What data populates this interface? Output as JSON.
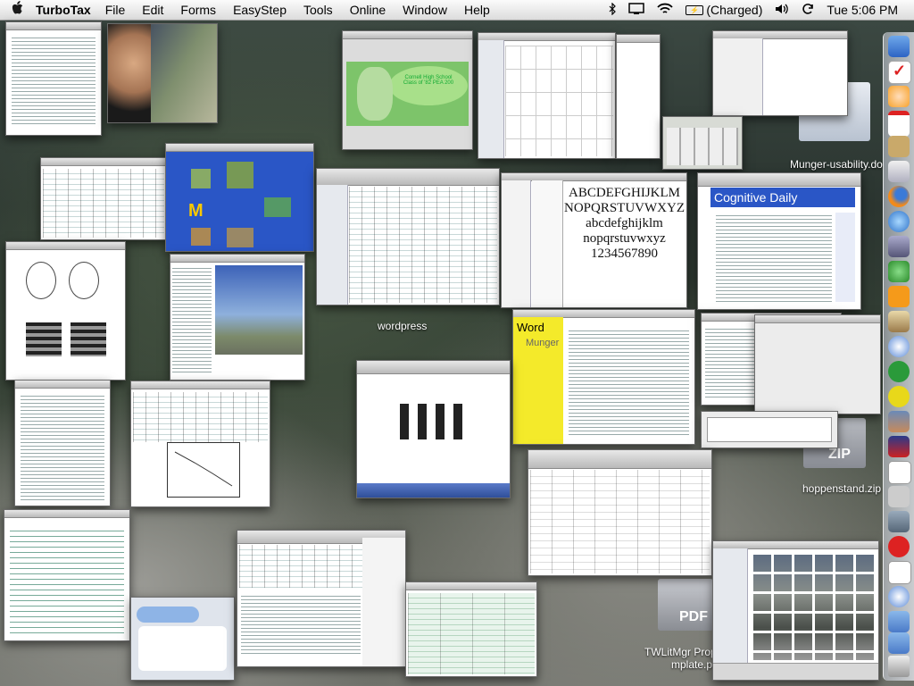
{
  "menubar": {
    "app_name": "TurboTax",
    "items": [
      "File",
      "Edit",
      "Forms",
      "EasyStep",
      "Tools",
      "Online",
      "Window",
      "Help"
    ],
    "battery_status": "(Charged)",
    "clock": "Tue 5:06 PM"
  },
  "windows": {
    "cornell_title": "Cornell High School",
    "cornell_class": "Class of '82 PEA 200",
    "font_lines": [
      "ABCDEFGHIJKLM",
      "NOPQRSTUVWXYZ",
      "abcdefghijklm",
      "nopqrstuvwxyz",
      "1234567890"
    ],
    "blog_title": "Cognitive Daily",
    "word_brand": "Word",
    "word_sub": "Munger"
  },
  "desktop_labels": {
    "munger": "Munger-usability.do",
    "wordpress": "wordpress",
    "zip_icon": "ZIP",
    "zip_file": "hoppenstand.zip",
    "pdf_icon": "PDF",
    "twlit": "TWLitMgr Prop",
    "twlit2": "mplate.pd"
  },
  "colors": {
    "accent_blue": "#2a56c6",
    "yellow": "#f4ea2a",
    "green": "#7dc46a"
  }
}
